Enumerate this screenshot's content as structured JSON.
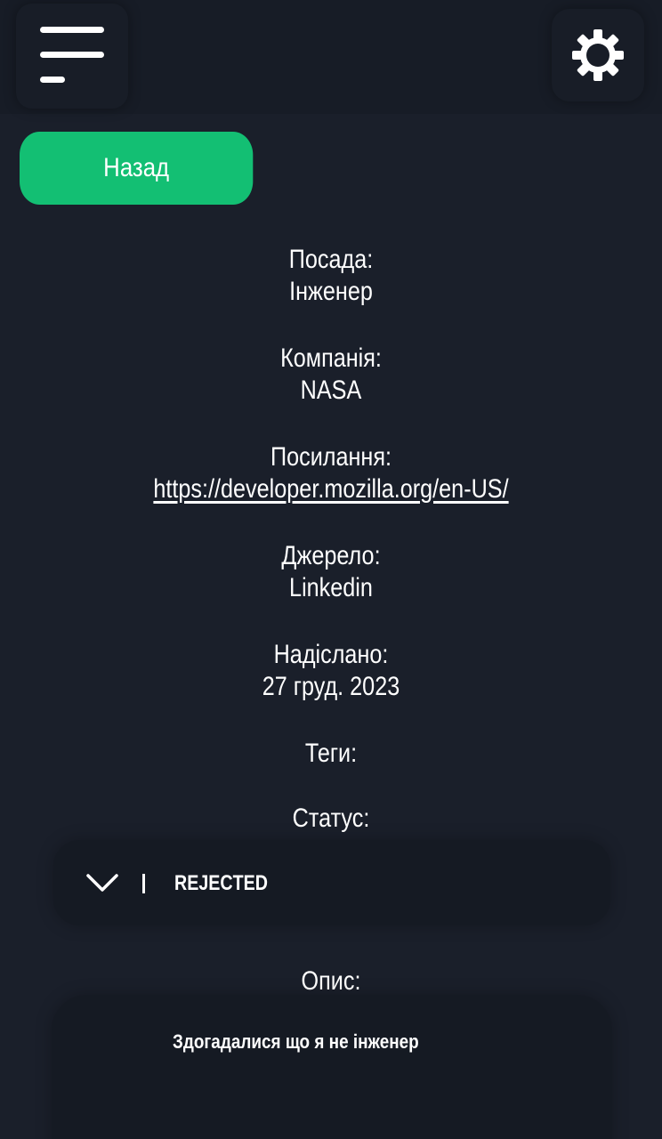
{
  "header": {
    "menu_icon": "hamburger-menu-icon",
    "settings_icon": "gear-icon"
  },
  "back_button": {
    "label": "Назад"
  },
  "details": {
    "position": {
      "label": "Посада:",
      "value": "Інженер"
    },
    "company": {
      "label": "Компанія:",
      "value": "NASA"
    },
    "link": {
      "label": "Посилання:",
      "value": "https://developer.mozilla.org/en-US/"
    },
    "source": {
      "label": "Джерело:",
      "value": "Linkedin"
    },
    "sent": {
      "label": "Надіслано:",
      "value": "27 груд. 2023"
    },
    "tags": {
      "label": "Теги:"
    },
    "status": {
      "label": "Статус:",
      "value": "REJECTED"
    },
    "description": {
      "label": "Опис:",
      "value": "Здогадалися що я не інженер"
    }
  },
  "colors": {
    "background": "#1a1f2a",
    "accent": "#13bf73",
    "card": "#151a23"
  }
}
